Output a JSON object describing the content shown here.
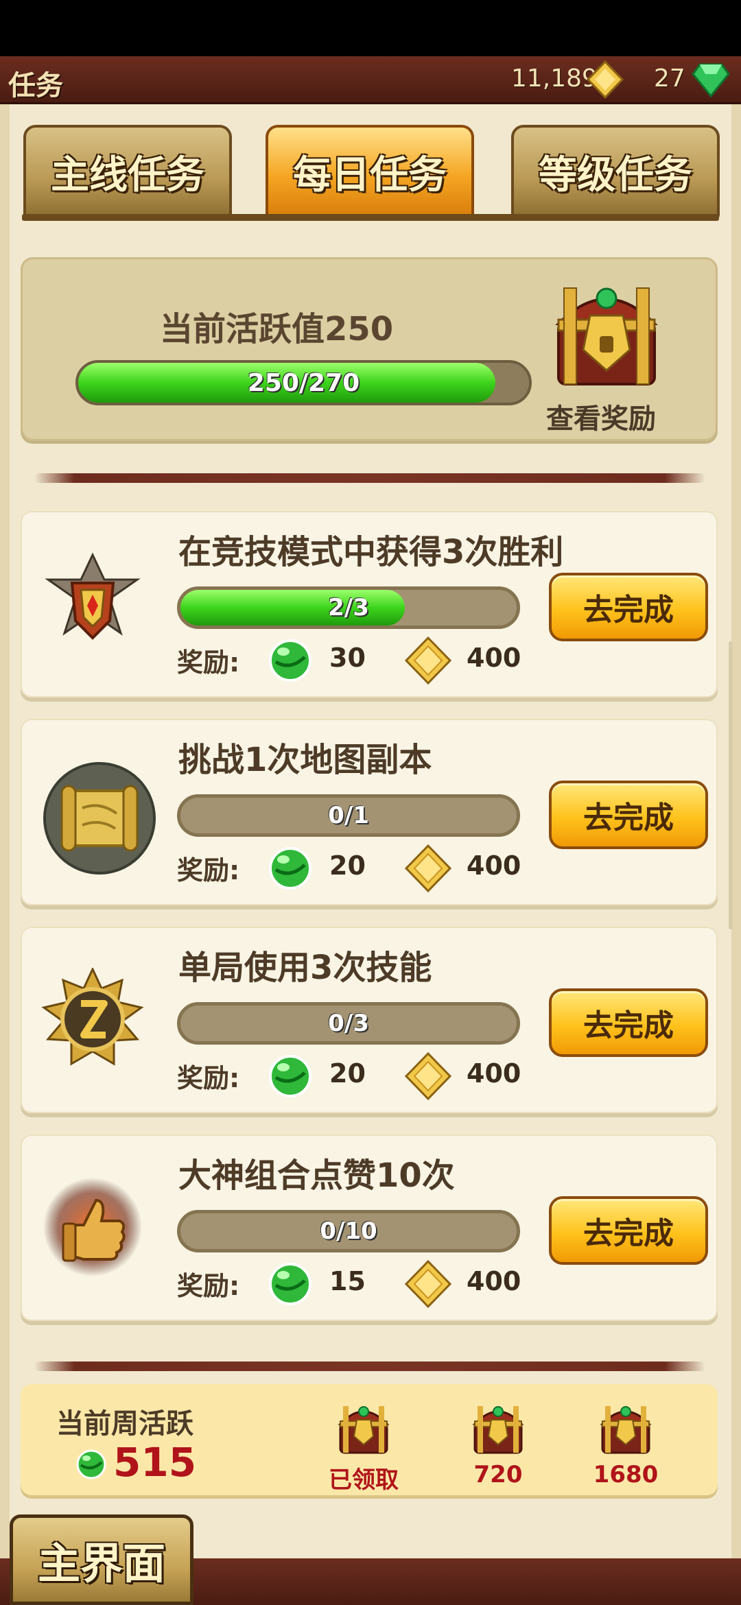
{
  "header": {
    "title": "任务",
    "gold": "11,189",
    "gems": "27"
  },
  "tabs": [
    {
      "label": "主线任务",
      "active": false
    },
    {
      "label": "每日任务",
      "active": true
    },
    {
      "label": "等级任务",
      "active": false
    }
  ],
  "activity": {
    "title": "当前活跃值250",
    "progress_label": "250/270",
    "progress": 0.926,
    "view_reward": "查看奖励"
  },
  "tasks": [
    {
      "title": "在竞技模式中获得3次胜利",
      "progress_label": "2/3",
      "progress": 0.667,
      "reward_label": "奖励:",
      "orb": "30",
      "gold": "400",
      "button": "去完成",
      "icon": "shield-emblem-icon"
    },
    {
      "title": "挑战1次地图副本",
      "progress_label": "0/1",
      "progress": 0,
      "reward_label": "奖励:",
      "orb": "20",
      "gold": "400",
      "button": "去完成",
      "icon": "map-scroll-icon"
    },
    {
      "title": "单局使用3次技能",
      "progress_label": "0/3",
      "progress": 0,
      "reward_label": "奖励:",
      "orb": "20",
      "gold": "400",
      "button": "去完成",
      "icon": "skill-emblem-icon"
    },
    {
      "title": "大神组合点赞10次",
      "progress_label": "0/10",
      "progress": 0,
      "reward_label": "奖励:",
      "orb": "15",
      "gold": "400",
      "button": "去完成",
      "icon": "thumbs-up-icon"
    }
  ],
  "weekly": {
    "title": "当前周活跃",
    "value": "515",
    "chests": [
      {
        "label": "已领取"
      },
      {
        "label": "720"
      },
      {
        "label": "1680"
      }
    ]
  },
  "footer": {
    "main_button": "主界面"
  },
  "colors": {
    "header_brown": "#6b2d1f",
    "paper": "#f1e8cf",
    "progress_green": "#3dd41c",
    "button_gold": "#ffc21c",
    "weekly_red": "#b0141a"
  }
}
